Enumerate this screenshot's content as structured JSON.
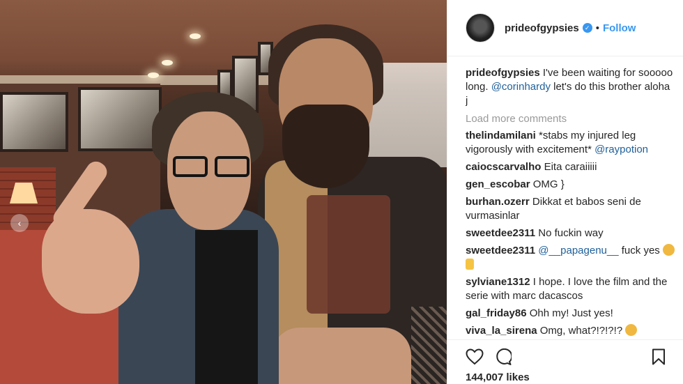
{
  "photo": {
    "prev_arrow": "‹"
  },
  "header": {
    "username": "prideofgypsies",
    "verified_mark": "✓",
    "separator": "•",
    "follow_label": "Follow"
  },
  "caption": {
    "user": "prideofgypsies",
    "text_before": " I've been waiting for sooooo long. ",
    "mention": "@corinhardy",
    "text_after": " let's do this brother aloha j"
  },
  "load_more": "Load more comments",
  "comments": [
    {
      "user": "thelindamilani",
      "text": " *stabs my injured leg vigorously with excitement* ",
      "mention": "@raypotion"
    },
    {
      "user": "caiocscarvalho",
      "text": " Eita caraiiiii"
    },
    {
      "user": "gen_escobar",
      "text": " OMG }"
    },
    {
      "user": "burhan.ozerr",
      "text": " Dikkat et babos seni de vurmasinlar"
    },
    {
      "user": "sweetdee2311",
      "text": " No fuckin way"
    },
    {
      "user": "sweetdee2311",
      "mention": " @__papagenu__",
      "text": " fuck yes "
    },
    {
      "user": "sylviane1312",
      "text": " I hope. I love the film and the serie with marc dacascos"
    },
    {
      "user": "gal_friday86",
      "text": " Ohh my! Just yes!"
    },
    {
      "user": "viva_la_sirena",
      "text": " Omg, what?!?!?!? "
    }
  ],
  "actions": {
    "icons": [
      "heart-icon",
      "comment-icon",
      "bookmark-icon"
    ],
    "likes": "144,007 likes"
  },
  "colors": {
    "accent": "#3897f0",
    "mention": "#1f5f99",
    "muted": "#999999",
    "text": "#262626"
  }
}
